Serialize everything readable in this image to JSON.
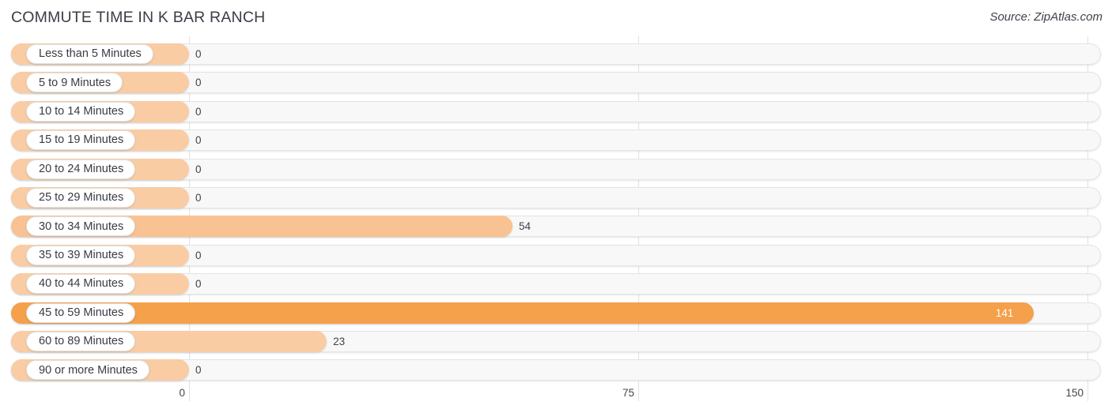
{
  "header": {
    "title": "COMMUTE TIME IN K BAR RANCH",
    "source": "Source: ZipAtlas.com"
  },
  "colors": {
    "bar_light": "#f9cca4",
    "bar_mid": "#f9c293",
    "bar_strong": "#f5a04b",
    "track": "#f8f8f8",
    "grid": "#e2e2e2",
    "text": "#3a3a46"
  },
  "chart_data": {
    "type": "bar",
    "orientation": "horizontal",
    "title": "COMMUTE TIME IN K BAR RANCH",
    "xlabel": "",
    "ylabel": "",
    "xlim": [
      0,
      150
    ],
    "ticks": [
      "0",
      "75",
      "150"
    ],
    "grid": true,
    "legend": "none",
    "categories": [
      "Less than 5 Minutes",
      "5 to 9 Minutes",
      "10 to 14 Minutes",
      "15 to 19 Minutes",
      "20 to 24 Minutes",
      "25 to 29 Minutes",
      "30 to 34 Minutes",
      "35 to 39 Minutes",
      "40 to 44 Minutes",
      "45 to 59 Minutes",
      "60 to 89 Minutes",
      "90 or more Minutes"
    ],
    "values": [
      0,
      0,
      0,
      0,
      0,
      0,
      54,
      0,
      0,
      141,
      23,
      0
    ],
    "value_labels": [
      "0",
      "0",
      "0",
      "0",
      "0",
      "0",
      "54",
      "0",
      "0",
      "141",
      "23",
      "0"
    ]
  },
  "rows": [
    {
      "label": "Less than 5 Minutes",
      "value_label": "0",
      "value": 0
    },
    {
      "label": "5 to 9 Minutes",
      "value_label": "0",
      "value": 0
    },
    {
      "label": "10 to 14 Minutes",
      "value_label": "0",
      "value": 0
    },
    {
      "label": "15 to 19 Minutes",
      "value_label": "0",
      "value": 0
    },
    {
      "label": "20 to 24 Minutes",
      "value_label": "0",
      "value": 0
    },
    {
      "label": "25 to 29 Minutes",
      "value_label": "0",
      "value": 0
    },
    {
      "label": "30 to 34 Minutes",
      "value_label": "54",
      "value": 54
    },
    {
      "label": "35 to 39 Minutes",
      "value_label": "0",
      "value": 0
    },
    {
      "label": "40 to 44 Minutes",
      "value_label": "0",
      "value": 0
    },
    {
      "label": "45 to 59 Minutes",
      "value_label": "141",
      "value": 141
    },
    {
      "label": "60 to 89 Minutes",
      "value_label": "23",
      "value": 23
    },
    {
      "label": "90 or more Minutes",
      "value_label": "0",
      "value": 0
    }
  ],
  "axis": {
    "ticks": [
      {
        "label": "0",
        "value": 0
      },
      {
        "label": "75",
        "value": 75
      },
      {
        "label": "150",
        "value": 150
      }
    ]
  }
}
